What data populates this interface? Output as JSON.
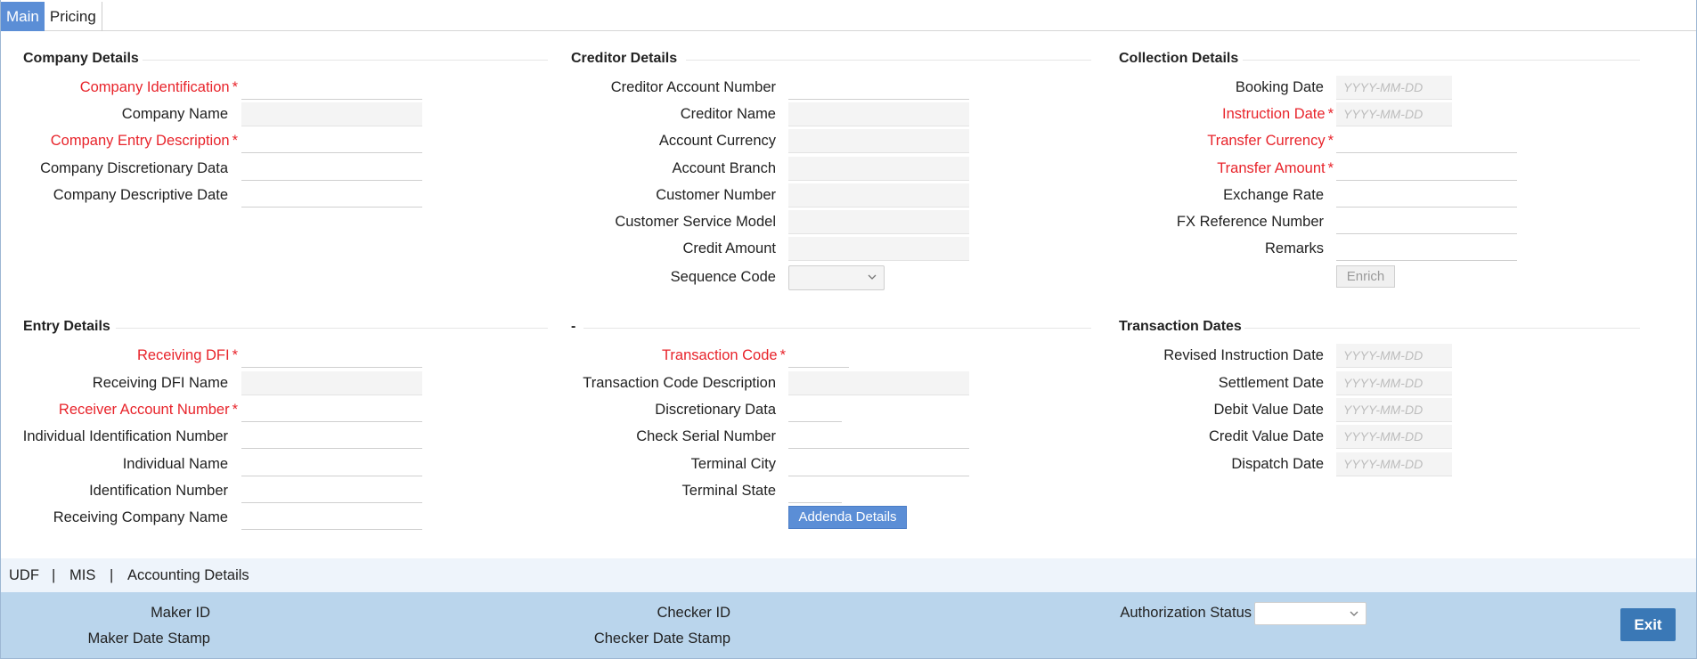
{
  "tabs": [
    {
      "label": "Main",
      "active": true
    },
    {
      "label": "Pricing",
      "active": false
    }
  ],
  "sections": {
    "company": {
      "title": "Company Details",
      "fields": [
        {
          "label": "Company Identification",
          "required": true
        },
        {
          "label": "Company Name",
          "required": false
        },
        {
          "label": "Company Entry Description",
          "required": true
        },
        {
          "label": "Company Discretionary Data",
          "required": false
        },
        {
          "label": "Company Descriptive Date",
          "required": false
        }
      ]
    },
    "creditor": {
      "title": "Creditor Details",
      "fields": [
        {
          "label": "Creditor Account Number"
        },
        {
          "label": "Creditor Name"
        },
        {
          "label": "Account Currency"
        },
        {
          "label": "Account Branch"
        },
        {
          "label": "Customer Number"
        },
        {
          "label": "Customer Service Model"
        },
        {
          "label": "Credit Amount"
        },
        {
          "label": "Sequence Code"
        }
      ]
    },
    "collection": {
      "title": "Collection Details",
      "fields": [
        {
          "label": "Booking Date",
          "placeholder": "YYYY-MM-DD"
        },
        {
          "label": "Instruction Date",
          "required": true,
          "placeholder": "YYYY-MM-DD"
        },
        {
          "label": "Transfer Currency",
          "required": true
        },
        {
          "label": "Transfer Amount",
          "required": true
        },
        {
          "label": "Exchange Rate"
        },
        {
          "label": "FX Reference Number"
        },
        {
          "label": "Remarks"
        }
      ],
      "enrich_label": "Enrich"
    },
    "entry": {
      "title": "Entry Details",
      "fields": [
        {
          "label": "Receiving DFI",
          "required": true
        },
        {
          "label": "Receiving DFI Name"
        },
        {
          "label": "Receiver Account Number",
          "required": true
        },
        {
          "label": "Individual Identification Number"
        },
        {
          "label": "Individual Name"
        },
        {
          "label": "Identification Number"
        },
        {
          "label": "Receiving Company Name"
        }
      ]
    },
    "transaction": {
      "title": "-",
      "fields": [
        {
          "label": "Transaction Code",
          "required": true
        },
        {
          "label": "Transaction Code Description"
        },
        {
          "label": "Discretionary Data"
        },
        {
          "label": "Check Serial Number"
        },
        {
          "label": "Terminal City"
        },
        {
          "label": "Terminal State"
        }
      ],
      "addenda_label": "Addenda Details"
    },
    "dates": {
      "title": "Transaction Dates",
      "fields": [
        {
          "label": "Revised Instruction Date",
          "placeholder": "YYYY-MM-DD"
        },
        {
          "label": "Settlement Date",
          "placeholder": "YYYY-MM-DD"
        },
        {
          "label": "Debit Value Date",
          "placeholder": "YYYY-MM-DD"
        },
        {
          "label": "Credit Value Date",
          "placeholder": "YYYY-MM-DD"
        },
        {
          "label": "Dispatch Date",
          "placeholder": "YYYY-MM-DD"
        }
      ]
    }
  },
  "bottom_links": [
    "UDF",
    "|",
    "MIS",
    "|",
    "Accounting Details"
  ],
  "footer": {
    "maker_id": "Maker ID",
    "maker_date": "Maker Date Stamp",
    "checker_id": "Checker ID",
    "checker_date": "Checker Date Stamp",
    "auth_status": "Authorization Status",
    "exit": "Exit"
  },
  "colors": {
    "accent": "#5b8ed6",
    "required": "#e8242b",
    "footer_bg": "#bad5ec"
  }
}
